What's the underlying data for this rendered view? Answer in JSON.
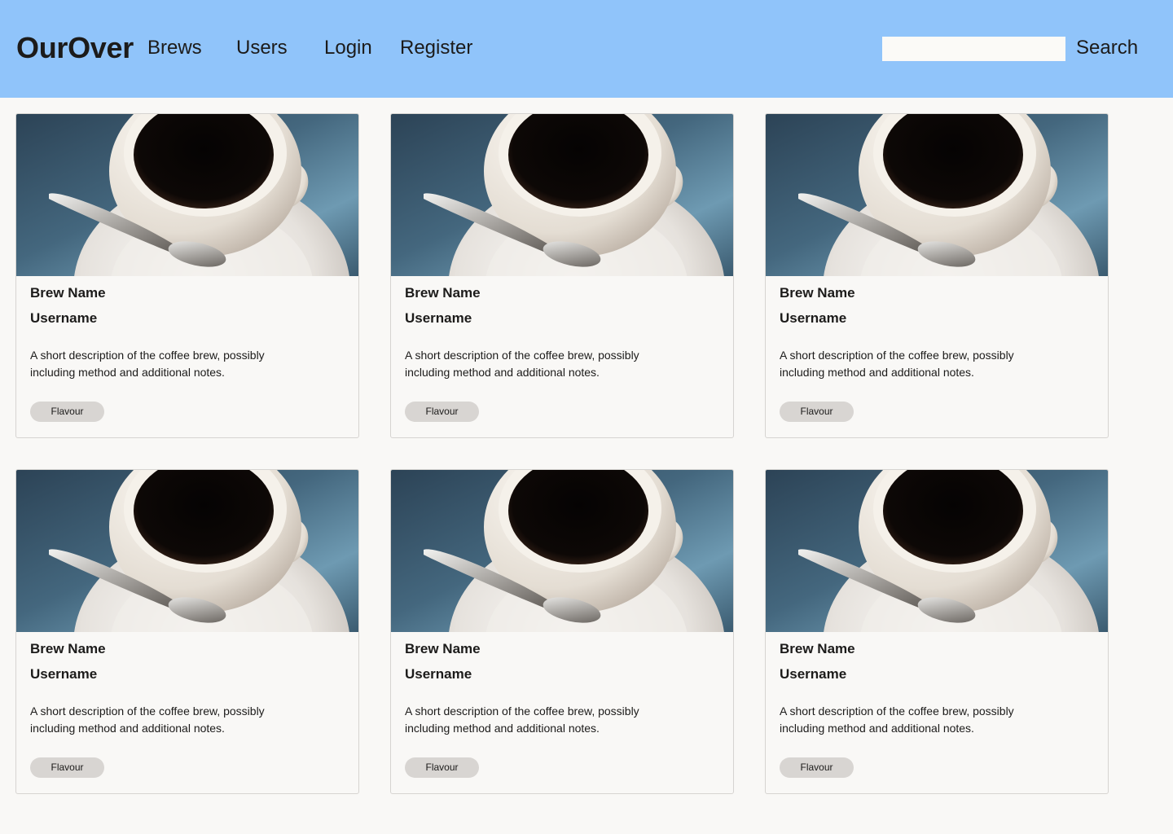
{
  "navbar": {
    "brand": "OurOver",
    "links": [
      "Brews",
      "Users",
      "Login",
      "Register"
    ],
    "search": {
      "value": "",
      "placeholder": "",
      "button_label": "Search"
    }
  },
  "colors": {
    "navbar_bg": "#90c4fa",
    "page_bg": "#f9f8f6",
    "tag_bg": "#d8d5d2",
    "card_border": "#d6d4d1"
  },
  "cards": [
    {
      "image": "coffee-cup-image",
      "brew_name": "Brew Name",
      "username": "Username",
      "description": "A short description of the coffee brew, possibly including method and additional notes.",
      "tag": "Flavour"
    },
    {
      "image": "coffee-cup-image",
      "brew_name": "Brew Name",
      "username": "Username",
      "description": "A short description of the coffee brew, possibly including method and additional notes.",
      "tag": "Flavour"
    },
    {
      "image": "coffee-cup-image",
      "brew_name": "Brew Name",
      "username": "Username",
      "description": "A short description of the coffee brew, possibly including method and additional notes.",
      "tag": "Flavour"
    },
    {
      "image": "coffee-cup-image",
      "brew_name": "Brew Name",
      "username": "Username",
      "description": "A short description of the coffee brew, possibly including method and additional notes.",
      "tag": "Flavour"
    },
    {
      "image": "coffee-cup-image",
      "brew_name": "Brew Name",
      "username": "Username",
      "description": "A short description of the coffee brew, possibly including method and additional notes.",
      "tag": "Flavour"
    },
    {
      "image": "coffee-cup-image",
      "brew_name": "Brew Name",
      "username": "Username",
      "description": "A short description of the coffee brew, possibly including method and additional notes.",
      "tag": "Flavour"
    }
  ]
}
